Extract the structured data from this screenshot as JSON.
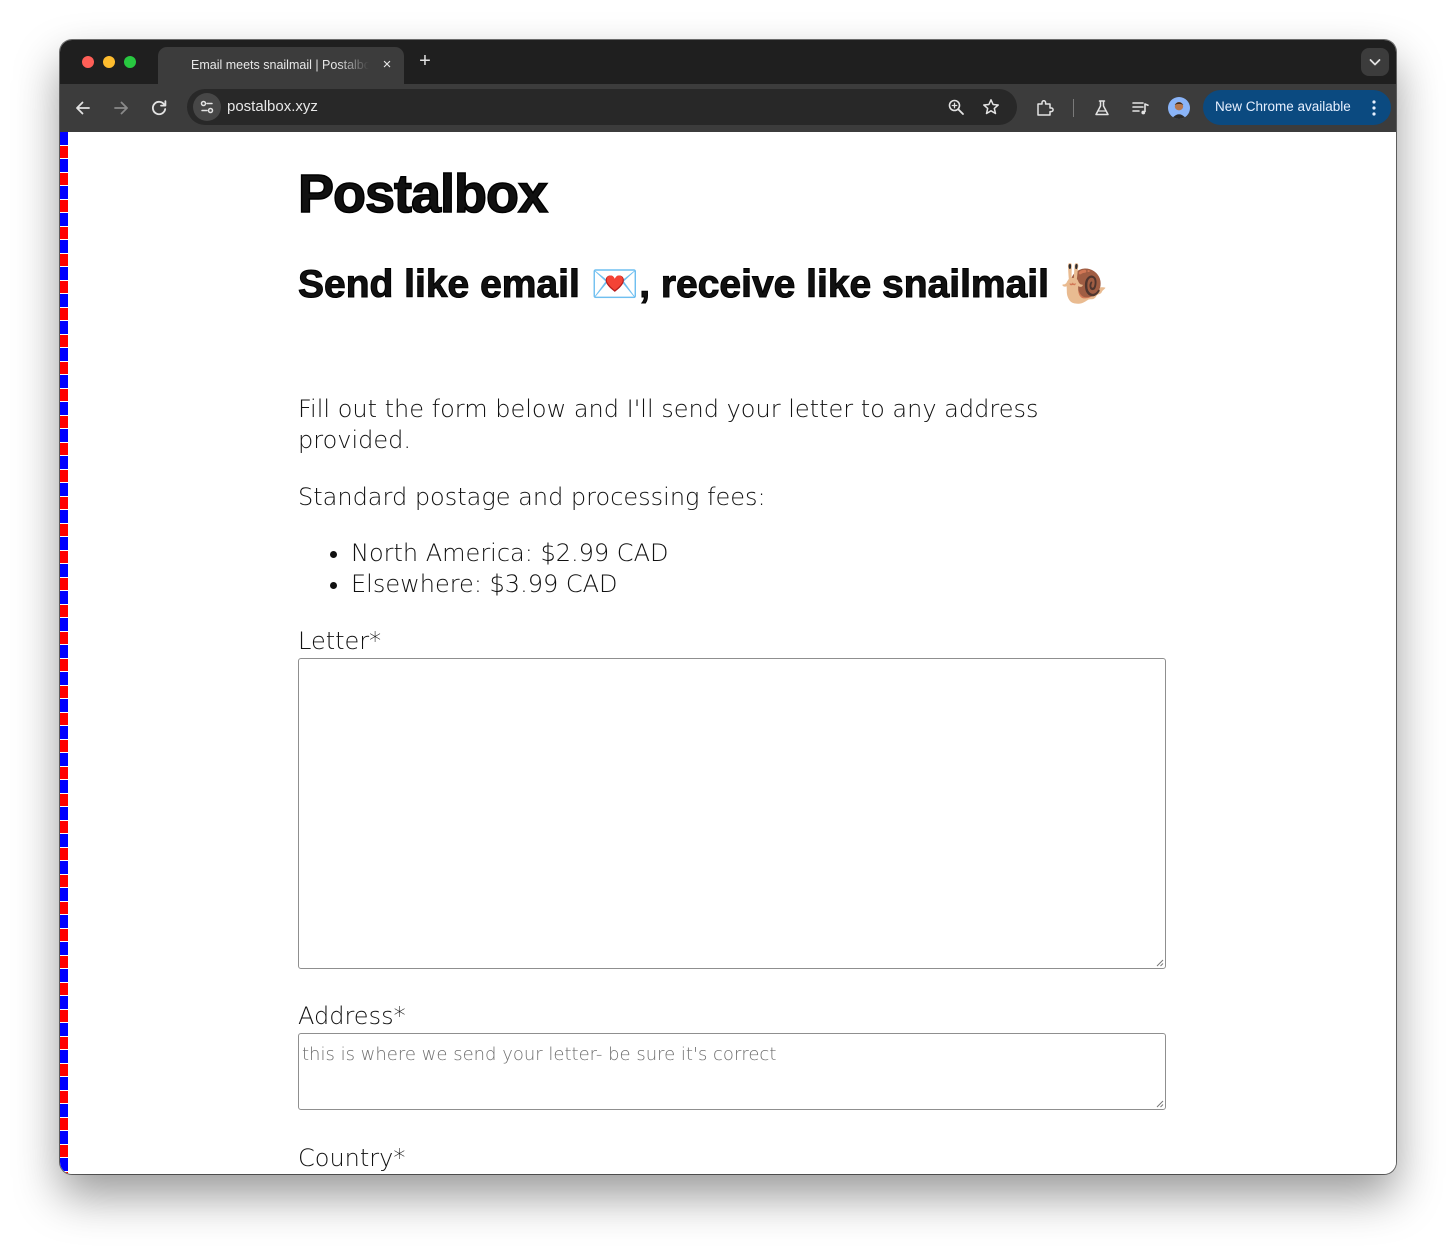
{
  "browser": {
    "tab_title": "Email meets snailmail | Postalbox",
    "tab_close": "×",
    "new_tab": "+",
    "url": "postalbox.xyz",
    "update_label": "New Chrome available"
  },
  "page": {
    "site_title": "Postalbox",
    "tagline_part1": "Send like email ",
    "tagline_emoji1": "💌",
    "tagline_part2": ", receive like snailmail ",
    "tagline_emoji2": "🐌",
    "intro": "Fill out the form below and I'll send your letter to any address provided.",
    "fees_heading": "Standard postage and processing fees:",
    "fees": [
      "North America: $2.99 CAD",
      "Elsewhere: $3.99 CAD"
    ],
    "form": {
      "letter_label": "Letter*",
      "letter_value": "",
      "address_label": "Address*",
      "address_placeholder": "this is where we send your letter- be sure it's correct",
      "country_label": "Country*"
    }
  },
  "icons": {
    "back": "arrow-left-icon",
    "forward": "arrow-right-icon",
    "reload": "reload-icon",
    "site_info": "tune-icon",
    "zoom": "zoom-icon",
    "bookmark": "star-icon",
    "extensions": "puzzle-icon",
    "labs": "flask-icon",
    "media": "media-queue-icon",
    "menu": "more-vert-icon"
  },
  "colors": {
    "titlebar": "#1f1f1f",
    "toolbar": "#3c3c3c",
    "update_button": "#0b4a80",
    "airmail_red": "#ff0000",
    "airmail_blue": "#0000ff"
  }
}
